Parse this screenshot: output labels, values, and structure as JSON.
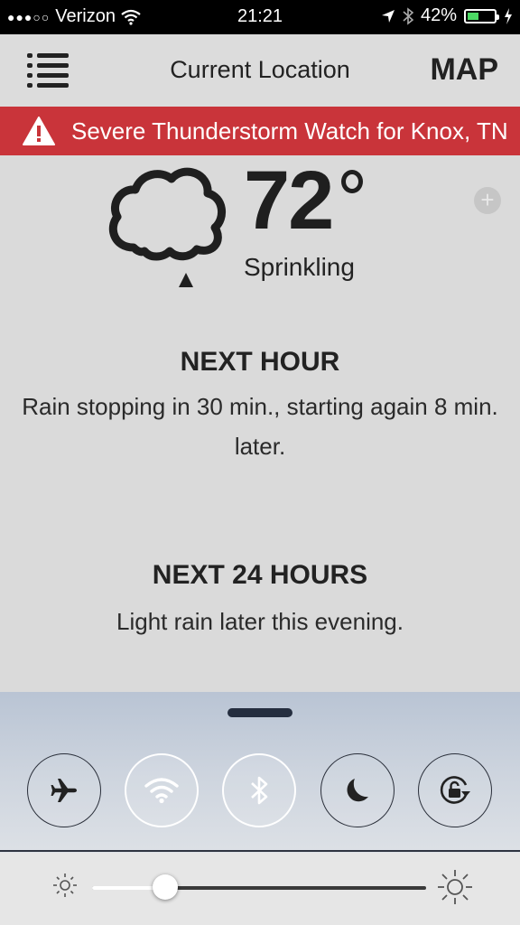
{
  "status_bar": {
    "signal_dots": "●●●○○",
    "carrier": "Verizon",
    "time": "21:21",
    "battery_percent": "42%",
    "battery_level": 0.42
  },
  "header": {
    "title": "Current Location",
    "map_label": "MAP"
  },
  "alert": {
    "text": "Severe Thunderstorm Watch for Knox, TN",
    "color": "#c9343a"
  },
  "current": {
    "temperature": "72",
    "condition": "Sprinkling",
    "icon": "cloud-rain-icon"
  },
  "next_hour": {
    "title": "NEXT HOUR",
    "text": "Rain stopping in 30 min., starting again 8 min. later."
  },
  "next_24_hours": {
    "title": "NEXT 24 HOURS",
    "text": "Light rain later this evening."
  },
  "control_center": {
    "toggles": [
      {
        "name": "airplane-mode",
        "icon": "airplane-icon",
        "state": "off"
      },
      {
        "name": "wifi",
        "icon": "wifi-icon",
        "state": "on"
      },
      {
        "name": "bluetooth",
        "icon": "bluetooth-icon",
        "state": "on"
      },
      {
        "name": "do-not-disturb",
        "icon": "moon-icon",
        "state": "off"
      },
      {
        "name": "rotation-lock",
        "icon": "rotation-lock-icon",
        "state": "off"
      }
    ],
    "brightness": 0.22
  }
}
